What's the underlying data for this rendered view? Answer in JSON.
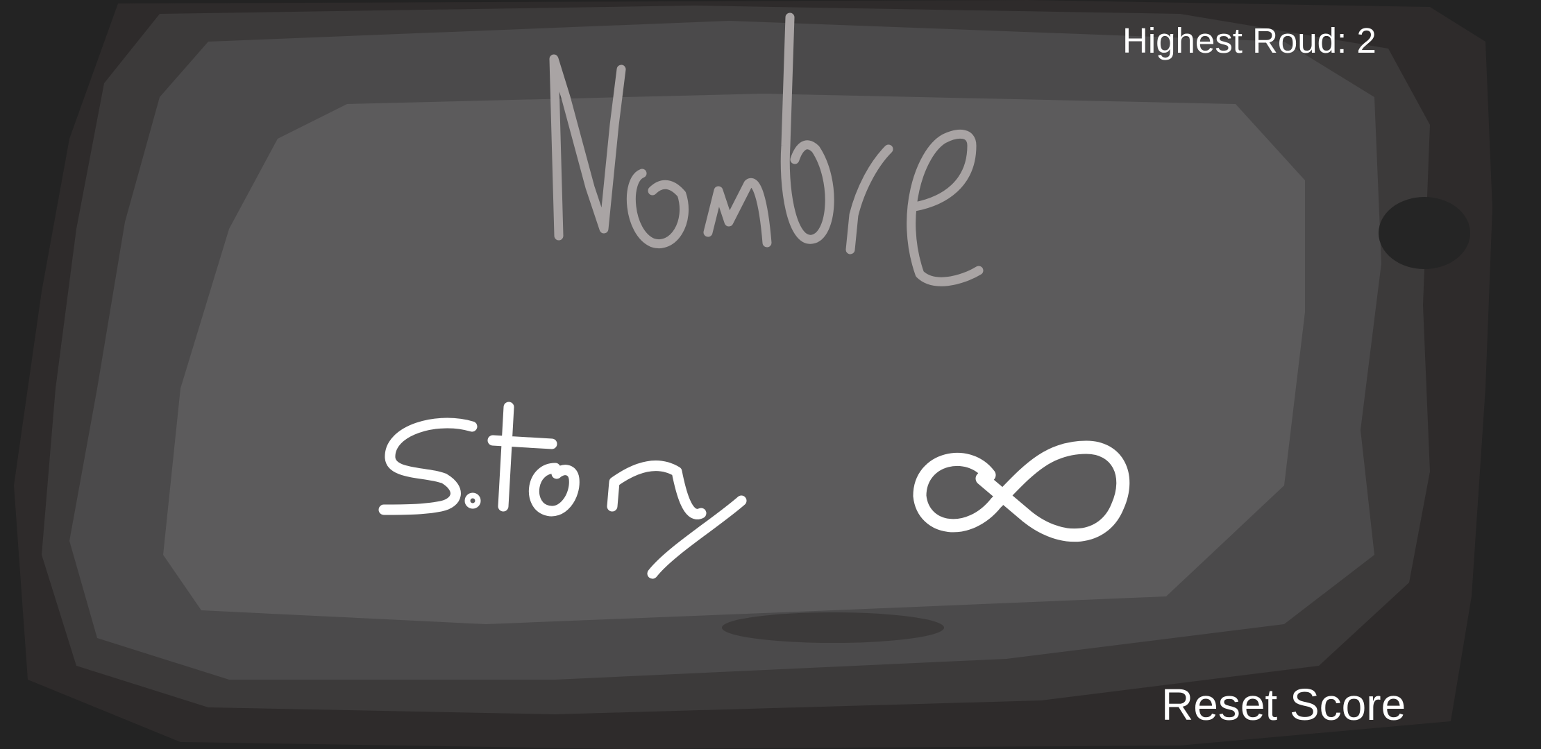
{
  "hud": {
    "highest_round_text": "Highest Roud: 2",
    "reset_score_label": "Reset Score"
  },
  "title": {
    "text": "Nombre"
  },
  "menu": {
    "story_label": "S.tory",
    "infinite_label": "∞"
  },
  "colors": {
    "outer_background": "#232323",
    "panel_dark": "#3c3a3a",
    "panel_mid": "#4b4a4b",
    "panel_light": "#5c5b5c",
    "title_ink": "#a9a4a4",
    "hud_text": "#ffffff"
  },
  "icons": {
    "infinite": "infinity-icon"
  }
}
